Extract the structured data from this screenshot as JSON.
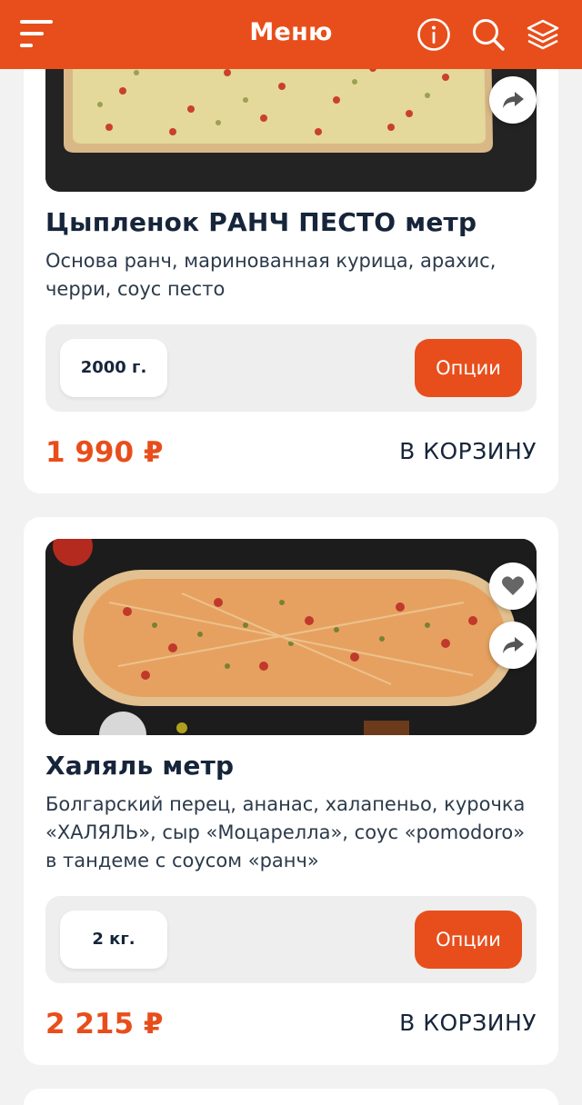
{
  "header": {
    "title": "Меню",
    "icons": [
      "menu-icon",
      "info-icon",
      "search-icon",
      "layers-icon"
    ]
  },
  "colors": {
    "accent": "#e84e1b",
    "text": "#16253a",
    "background": "#f2f2f2"
  },
  "products": [
    {
      "title": "Цыпленок РАНЧ ПЕСТО метр",
      "description_lines": [
        "Основа ранч, маринованная курица, арахис,",
        "черри, соус песто"
      ],
      "weight": "2000 г.",
      "options_label": "Опции",
      "price": "1 990 ₽",
      "cart_label": "В КОРЗИНУ",
      "actions": [
        "share-icon"
      ]
    },
    {
      "title": "Халяль метр",
      "description_lines": [
        "Болгарский перец, ананас, халапеньо, курочка",
        "«ХАЛЯЛЬ», сыр «Моцарелла», соус «pomodoro»",
        "в тандеме с соусом «ранч»"
      ],
      "weight": "2 кг.",
      "options_label": "Опции",
      "price": "2 215 ₽",
      "cart_label": "В КОРЗИНУ",
      "actions": [
        "heart-icon",
        "share-icon"
      ]
    }
  ]
}
